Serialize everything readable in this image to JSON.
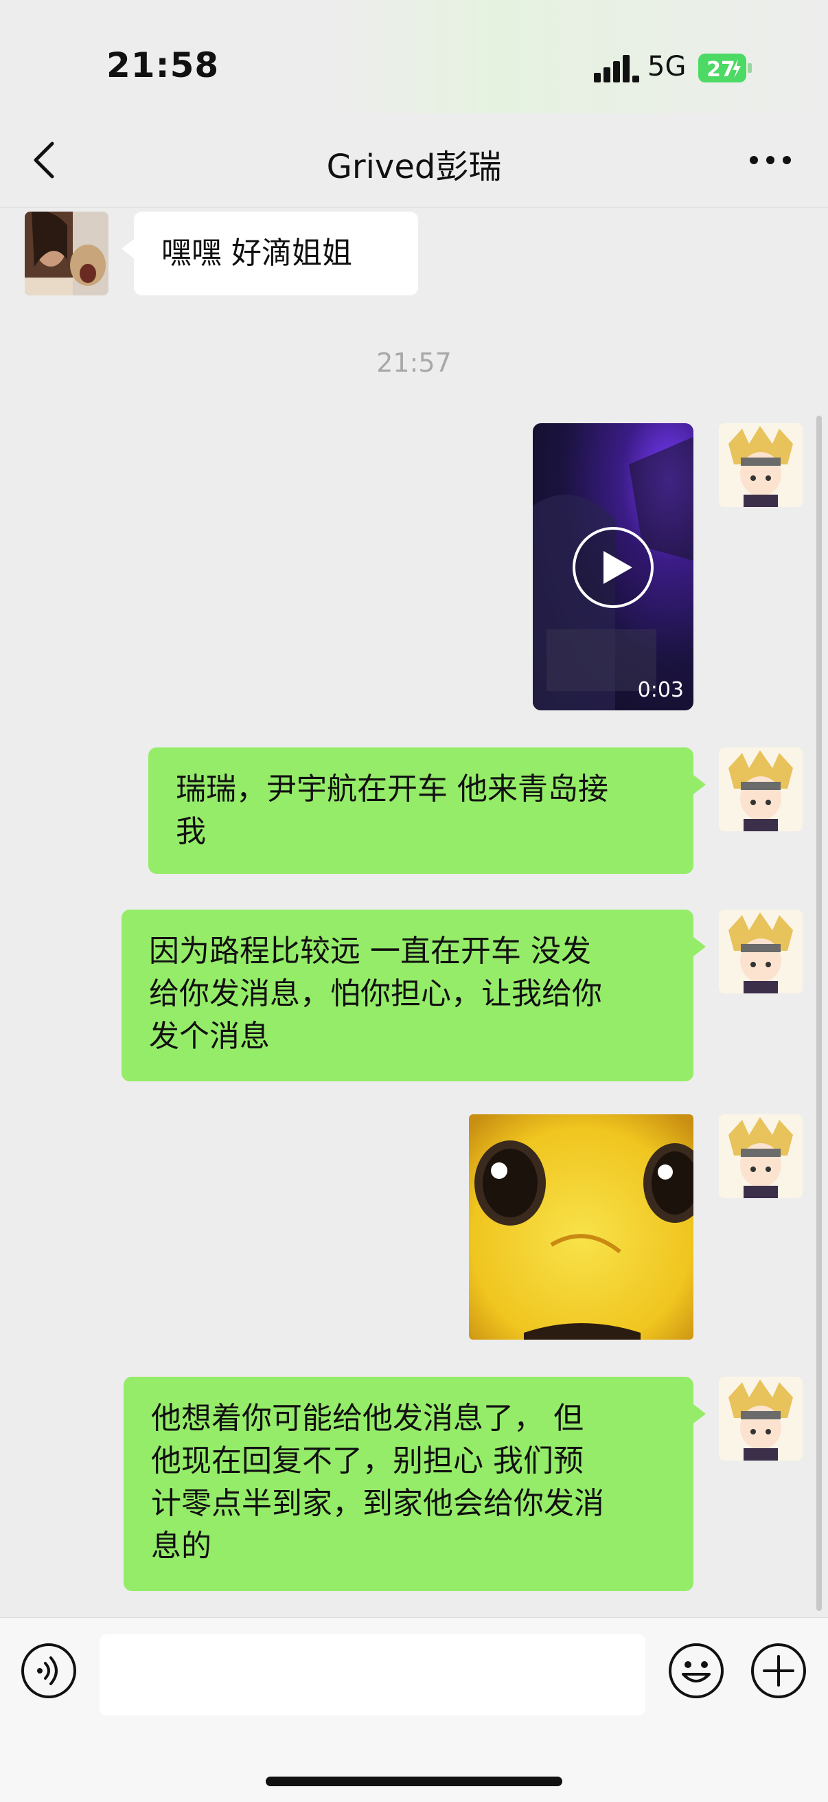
{
  "status_bar": {
    "time": "21:58",
    "network": "5G",
    "battery": "27",
    "icons": [
      "signal-icon",
      "battery-icon"
    ]
  },
  "nav": {
    "title": "Grived彭瑞",
    "icons": [
      "back-icon",
      "more-icon"
    ]
  },
  "messages": [
    {
      "side": "left",
      "type": "text",
      "text": "嘿嘿 好滴姐姐"
    },
    {
      "type": "timestamp",
      "text": "21:57"
    },
    {
      "side": "right",
      "type": "video",
      "duration": "0:03"
    },
    {
      "side": "right",
      "type": "text",
      "lines": [
        "瑞瑞，尹宇航在开车 他来青岛接",
        "我"
      ]
    },
    {
      "side": "right",
      "type": "text",
      "lines": [
        "因为路程比较远 一直在开车 没发",
        "给你发消息，怕你担心，让我给你",
        "发个消息"
      ]
    },
    {
      "side": "right",
      "type": "sticker"
    },
    {
      "side": "right",
      "type": "text",
      "lines": [
        "他想着你可能给他发消息了， 但",
        "他现在回复不了，别担心 我们预",
        "计零点半到家，到家他会给你发消",
        "息的"
      ]
    }
  ],
  "input_bar": {
    "value": "",
    "icons": [
      "voice-icon",
      "emoji-icon",
      "plus-icon"
    ]
  },
  "colors": {
    "background": "#ededed",
    "outgoing_bubble": "#95ec69",
    "incoming_bubble": "#ffffff",
    "battery": "#4cd964"
  }
}
